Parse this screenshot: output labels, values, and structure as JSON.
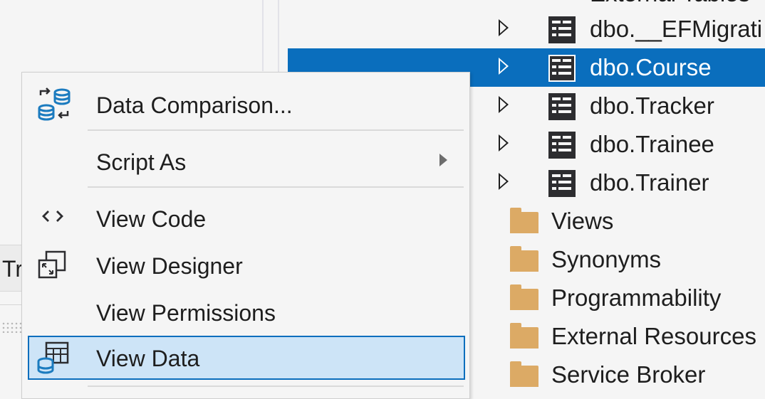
{
  "left_panel": {
    "tab_label": "Tr"
  },
  "tree": {
    "cutoff_label": "External Tables",
    "tables": [
      {
        "label": "dbo.__EFMigrati",
        "selected": false
      },
      {
        "label": "dbo.Course",
        "selected": true
      },
      {
        "label": "dbo.Tracker",
        "selected": false
      },
      {
        "label": "dbo.Trainee",
        "selected": false
      },
      {
        "label": "dbo.Trainer",
        "selected": false
      }
    ],
    "folders": [
      {
        "label": "Views"
      },
      {
        "label": "Synonyms"
      },
      {
        "label": "Programmability"
      },
      {
        "label": "External Resources"
      },
      {
        "label": "Service Broker"
      }
    ]
  },
  "context_menu": {
    "items": [
      {
        "label": "Data Comparison...",
        "icon": "data-comparison-icon"
      },
      {
        "label": "Script As",
        "icon": "",
        "has_submenu": true
      },
      {
        "label": "View Code",
        "icon": "code-brackets-icon"
      },
      {
        "label": "View Designer",
        "icon": "designer-icon"
      },
      {
        "label": "View Permissions",
        "icon": ""
      },
      {
        "label": "View Data",
        "icon": "view-data-icon",
        "highlighted": true
      }
    ]
  },
  "colors": {
    "selection": "#0a6ebd",
    "hover": "#cde4f7",
    "folder": "#dcaa65",
    "icon_blue": "#1b7bbf"
  }
}
